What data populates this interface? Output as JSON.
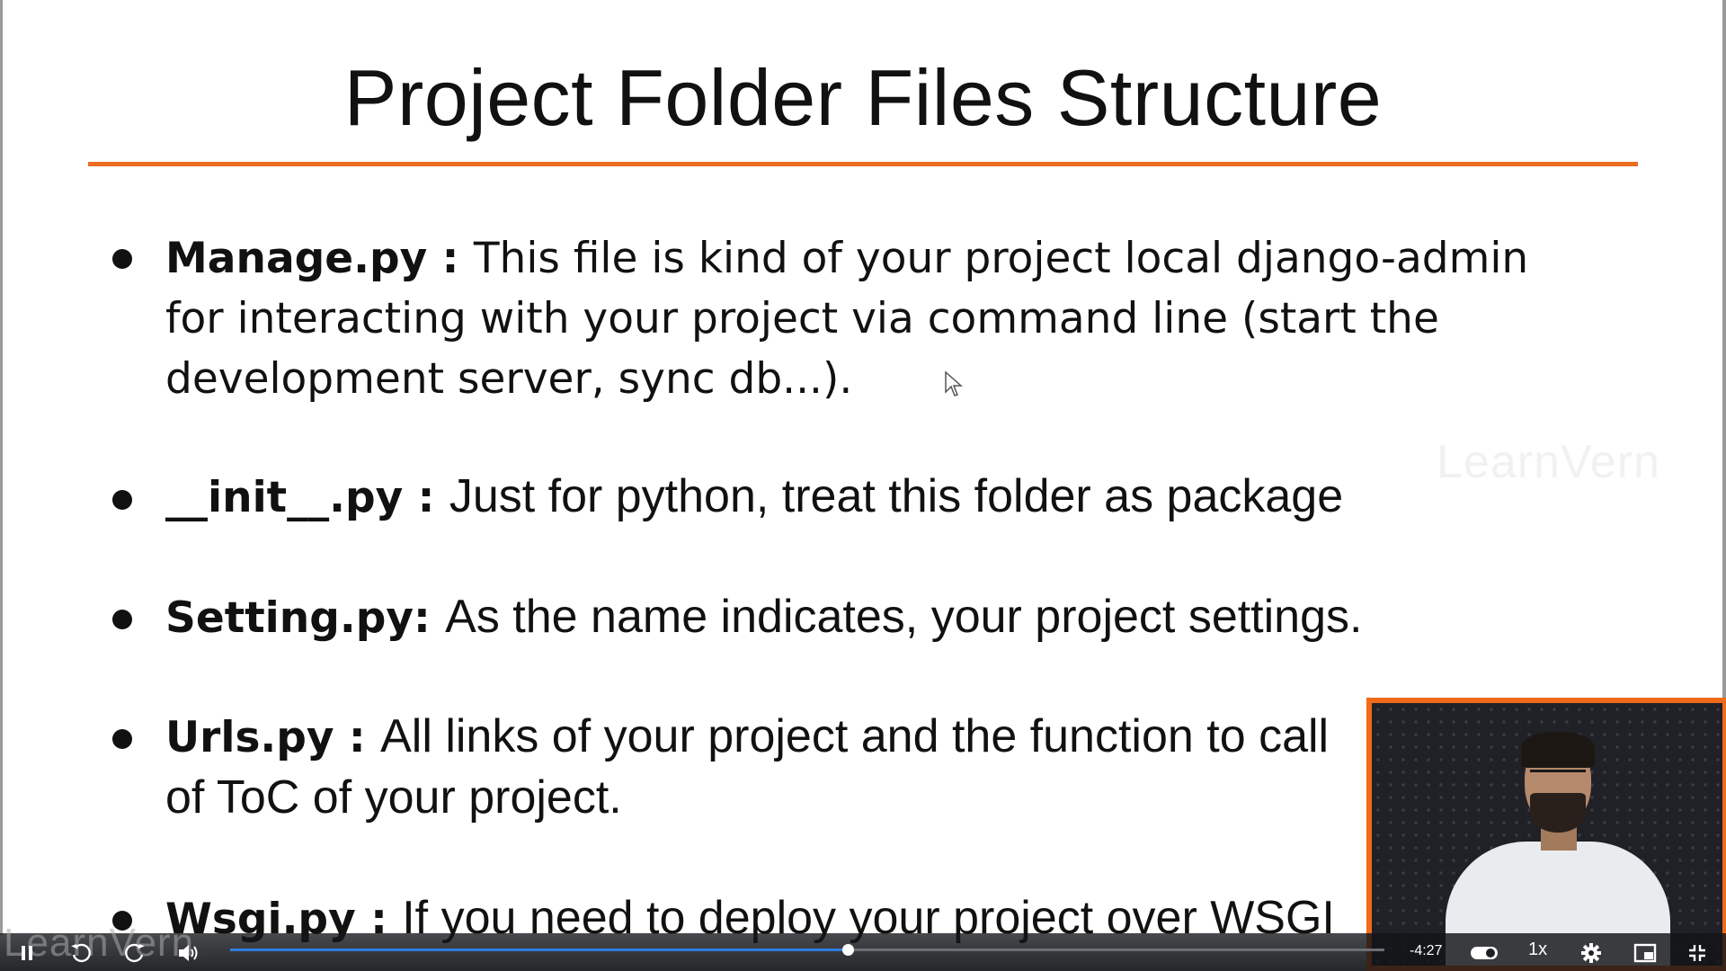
{
  "slide": {
    "title": "Project Folder Files Structure",
    "watermark": "LearnVern",
    "bullets": [
      {
        "key": "Manage.py : ",
        "text": " This file is kind of your project local django-admin for interacting with your project via command line (start the development server, sync db...)."
      },
      {
        "key": "__init__.py : ",
        "text": "Just for python, treat this folder as package"
      },
      {
        "key": "Setting.py: ",
        "text": "As the name indicates, your project settings."
      },
      {
        "key": "Urls.py : ",
        "text": "All links of your project and the function to call",
        "text_line2": "of ToC of your project."
      },
      {
        "key": "Wsgi.py : ",
        "text": "If you need to deploy your project over WSGI"
      }
    ]
  },
  "player": {
    "time_remaining": "-4:27",
    "speed": "1x",
    "logo": "LearnVern",
    "progress": 0.535
  },
  "icons": {
    "pause": "pause-icon",
    "rewind": "rewind-icon",
    "forward": "forward-icon",
    "volume": "volume-icon",
    "captions": "toggle-icon",
    "settings": "gear-icon",
    "pip": "pip-icon",
    "exit_fullscreen": "exit-fullscreen-icon"
  },
  "colors": {
    "accent": "#ec6c1f",
    "progress": "#2f7de0",
    "webcam_border": "#f06a1a"
  }
}
